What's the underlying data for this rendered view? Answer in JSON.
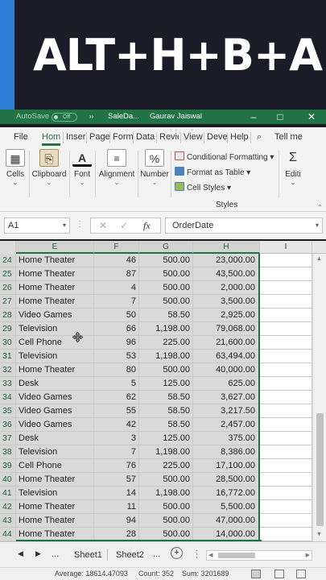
{
  "banner": {
    "caption": "ALT+H+B+A"
  },
  "titlebar": {
    "autosave_label": "AutoSave",
    "toggle_state": "Off",
    "file_name": "SaleDa...",
    "user_name": "Gaurav Jaiswal",
    "more_icon": "chevrons-icon"
  },
  "tabs": {
    "items": [
      "File",
      "Hom",
      "Inser",
      "Page",
      "Form",
      "Data",
      "Revie",
      "View",
      "Deve",
      "Help"
    ],
    "active": "Hom",
    "search_label": "Tell me"
  },
  "ribbon": {
    "cells": "Cells",
    "clipboard": "Clipboard",
    "font": "Font",
    "alignment": "Alignment",
    "number": "Number",
    "conditional_formatting": "Conditional Formatting",
    "format_as_table": "Format as Table",
    "cell_styles": "Cell Styles",
    "styles_group": "Styles",
    "editing": "Editi"
  },
  "formula_bar": {
    "name_box": "A1",
    "fx": "fx",
    "content": "OrderDate"
  },
  "columns": [
    "E",
    "F",
    "G",
    "H",
    "I"
  ],
  "rows": [
    {
      "n": "24",
      "e": "Home Theater",
      "f": "46",
      "g": "500.00",
      "h": "23,000.00"
    },
    {
      "n": "25",
      "e": "Home Theater",
      "f": "87",
      "g": "500.00",
      "h": "43,500.00"
    },
    {
      "n": "26",
      "e": "Home Theater",
      "f": "4",
      "g": "500.00",
      "h": "2,000.00"
    },
    {
      "n": "27",
      "e": "Home Theater",
      "f": "7",
      "g": "500.00",
      "h": "3,500.00"
    },
    {
      "n": "28",
      "e": "Video Games",
      "f": "50",
      "g": "58.50",
      "h": "2,925.00"
    },
    {
      "n": "29",
      "e": "Television",
      "f": "66",
      "g": "1,198.00",
      "h": "79,068.00"
    },
    {
      "n": "30",
      "e": "Cell Phone",
      "f": "96",
      "g": "225.00",
      "h": "21,600.00"
    },
    {
      "n": "31",
      "e": "Television",
      "f": "53",
      "g": "1,198.00",
      "h": "63,494.00"
    },
    {
      "n": "32",
      "e": "Home Theater",
      "f": "80",
      "g": "500.00",
      "h": "40,000.00"
    },
    {
      "n": "33",
      "e": "Desk",
      "f": "5",
      "g": "125.00",
      "h": "625.00"
    },
    {
      "n": "34",
      "e": "Video Games",
      "f": "62",
      "g": "58.50",
      "h": "3,627.00"
    },
    {
      "n": "35",
      "e": "Video Games",
      "f": "55",
      "g": "58.50",
      "h": "3,217.50"
    },
    {
      "n": "36",
      "e": "Video Games",
      "f": "42",
      "g": "58.50",
      "h": "2,457.00"
    },
    {
      "n": "37",
      "e": "Desk",
      "f": "3",
      "g": "125.00",
      "h": "375.00"
    },
    {
      "n": "38",
      "e": "Television",
      "f": "7",
      "g": "1,198.00",
      "h": "8,386.00"
    },
    {
      "n": "39",
      "e": "Cell Phone",
      "f": "76",
      "g": "225.00",
      "h": "17,100.00"
    },
    {
      "n": "40",
      "e": "Home Theater",
      "f": "57",
      "g": "500.00",
      "h": "28,500.00"
    },
    {
      "n": "41",
      "e": "Television",
      "f": "14",
      "g": "1,198.00",
      "h": "16,772.00"
    },
    {
      "n": "42",
      "e": "Home Theater",
      "f": "11",
      "g": "500.00",
      "h": "5,500.00"
    },
    {
      "n": "43",
      "e": "Home Theater",
      "f": "94",
      "g": "500.00",
      "h": "47,000.00"
    },
    {
      "n": "44",
      "e": "Home Theater",
      "f": "28",
      "g": "500.00",
      "h": "14,000.00"
    }
  ],
  "sheets": {
    "ellipsis": "...",
    "tabs": [
      "Sheet1",
      "Sheet2"
    ],
    "more": "..."
  },
  "status": {
    "average": "Average: 18614.47093",
    "count": "Count: 352",
    "sum": "Sum: 3201689"
  },
  "colors": {
    "excel_green": "#217346",
    "banner_bg": "#1c1c28",
    "banner_accent": "#2f7fd8",
    "selection_fill": "#d9d9d9"
  }
}
